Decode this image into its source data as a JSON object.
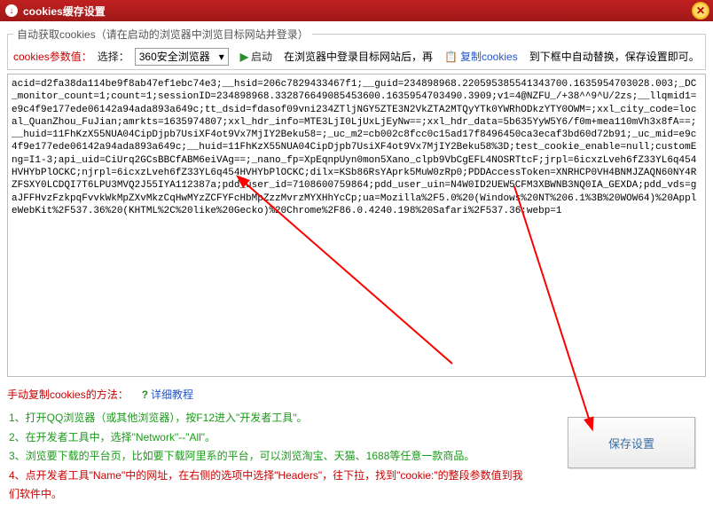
{
  "window": {
    "title": "cookies缓存设置"
  },
  "fieldset": {
    "legend": "自动获取cookies（请在启动的浏览器中浏览目标网站并登录）"
  },
  "row": {
    "param_label": "cookies参数值：",
    "select_label": "选择：",
    "browser_selected": "360安全浏览器",
    "start_label": "启动",
    "hint_mid": "在浏览器中登录目标网站后，再",
    "copy_label": "复制cookies",
    "hint_right": "到下框中自动替换，保存设置即可。"
  },
  "cookies_value": "acid=d2fa38da114be9f8ab47ef1ebc74e3;__hsid=206c7829433467f1;__guid=234898968.220595385541343700.1635954703028.003;_DC_monitor_count=1;count=1;sessionID=234898968.332876649085453600.1635954703490.3909;v1=4@NZFU_/+38^^9^U/2zs;__llqmid1=e9c4f9e177ede06142a94ada893a649c;tt_dsid=fdasof09vni234ZTljNGY5ZTE3N2VkZTA2MTQyYTk0YWRhODkzYTY0OWM=;xxl_city_code=local_QuanZhou_FuJian;amrkts=1635974807;xxl_hdr_info=MTE3LjI0LjUxLjEyNw==;xxl_hdr_data=5b635YyW5Y6/f0m+mea110mVh3x8fA==;__huid=11FhKzX55NUA04CipDjpb7UsiXF4ot9Vx7MjIY2Beku58=;_uc_m2=cb002c8fcc0c15ad17f8496450ca3ecaf3bd60d72b91;_uc_mid=e9c4f9e177ede06142a94ada893a649c;__huid=11FhKzX55NUA04CipDjpb7UsiXF4ot9Vx7MjIY2Beku58%3D;test_cookie_enable=null;customEng=I1-3;api_uid=CiUrq2GCsBBCfABM6eiVAg==;_nano_fp=XpEqnpUyn0mon5Xano_clpb9VbCgEFL4NOSRTtcF;jrpl=6icxzLveh6fZ33YL6q454HVHYbPlOCKC;njrpl=6icxzLveh6fZ33YL6q454HVHYbPlOCKC;dilx=KSb86RsYAprk5MuW0zRp0;PDDAccessToken=XNRHCP0VH4BNMJZAQN60NY4RZFSXY0LCDQI7T6LPU3MVQ2J55IYA112387a;pdd_user_id=7108600759864;pdd_user_uin=N4W0ID2UEW5CFM3XBWNB3NQ0IA_GEXDA;pdd_vds=gaJFFHvzFzkpqFvvkWkMpZXvMkzCqHwMYzZCFYFcHbMpZzzMvrzMYXHhYcCp;ua=Mozilla%2F5.0%20(Windows%20NT%206.1%3B%20WOW64)%20AppleWebKit%2F537.36%20(KHTML%2C%20like%20Gecko)%20Chrome%2F86.0.4240.198%20Safari%2F537.36;webp=1",
  "manual": {
    "title": "手动复制cookies的方法：",
    "tutorial": "详细教程"
  },
  "steps": {
    "s1": "1、打开QQ浏览器（或其他浏览器），按F12进入\"开发者工具\"。",
    "s2": "2、在开发者工具中，选择\"Network\"--\"All\"。",
    "s3": "3、浏览要下载的平台页，比如要下载阿里系的平台，可以浏览淘宝、天猫、1688等任意一款商品。",
    "s4": "4、点开发者工具\"Name\"中的网址，在右侧的选项中选择\"Headers\"，往下拉，找到\"cookie:\"的整段参数值到我们软件中。"
  },
  "save_button": "保存设置"
}
